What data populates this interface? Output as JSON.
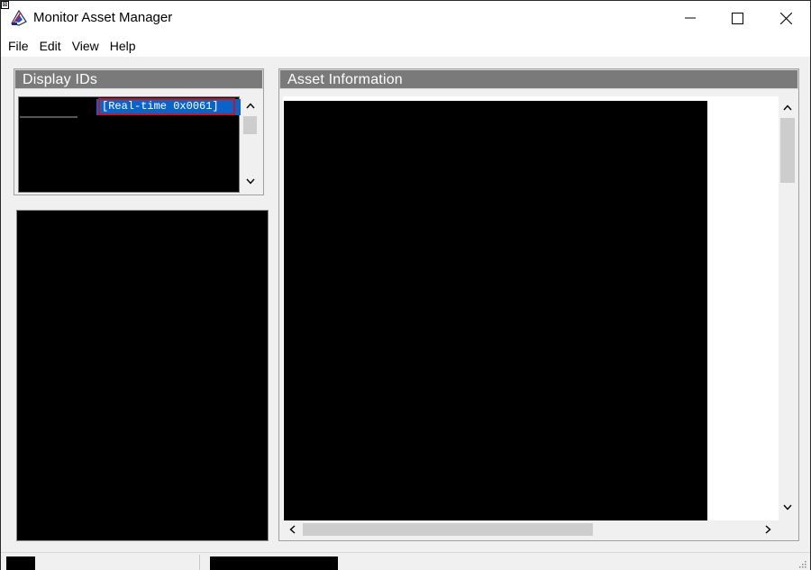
{
  "window": {
    "title": "Monitor Asset Manager",
    "sys_glyph": "⊠",
    "icon": "monitor-asset-app-icon"
  },
  "menu": {
    "items": [
      "File",
      "Edit",
      "View",
      "Help"
    ]
  },
  "display_ids": {
    "header": "Display IDs",
    "selected_item": "[Real-time 0x0061]"
  },
  "asset_information": {
    "header": "Asset Information"
  },
  "colors": {
    "header_bg": "#7a7a7a",
    "selection": "#0a63c9",
    "highlight_border": "#d0101f"
  }
}
